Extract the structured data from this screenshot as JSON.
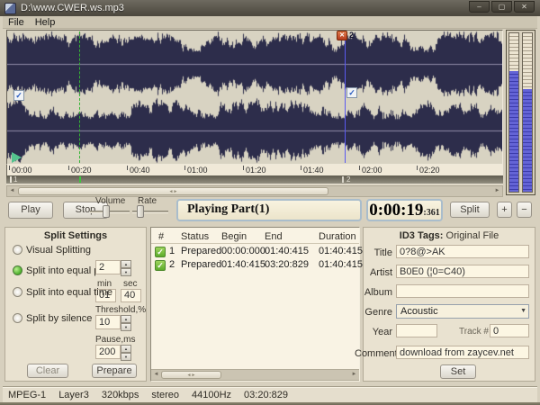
{
  "window": {
    "title": "D:\\www.CWER.ws.mp3",
    "minimize_glyph": "–",
    "maximize_glyph": "▢",
    "close_glyph": "✕"
  },
  "menu": {
    "items": [
      "File",
      "Help"
    ]
  },
  "waveform": {
    "ruler_labels": [
      "00:00",
      "00:20",
      "00:40",
      "01:00",
      "01:20",
      "01:40",
      "02:00",
      "02:20"
    ],
    "split_marker_number": "2",
    "marker_close_glyph": "✕",
    "marker_check_glyph": "✓",
    "strip_marker_start": "1",
    "strip_marker_split": "2"
  },
  "icons": {
    "scroll_left": "◄",
    "scroll_right": "►",
    "thumb_grip": "◄►",
    "spin_up": "▲",
    "spin_down": "▼",
    "dropdown_arrow": "▼"
  },
  "transport": {
    "play_label": "Play",
    "stop_label": "Stop",
    "volume_label": "Volume",
    "rate_label": "Rate",
    "status_text": "Playing Part(1)",
    "time_main": "0:00:19",
    "time_frac": ":361",
    "split_label": "Split",
    "plus_label": "+",
    "minus_label": "−"
  },
  "split_settings": {
    "title": "Split Settings",
    "option_visual": "Visual Splitting",
    "option_equal_parts": "Split into equal parts",
    "option_equal_time": "Split into equal time",
    "option_silence": "Split by silence",
    "parts_value": "2",
    "min_label": "min",
    "sec_label": "sec",
    "min_value": "01",
    "sec_value": "40",
    "threshold_label": "Threshold,%",
    "threshold_value": "10",
    "pause_label": "Pause,ms",
    "pause_value": "200",
    "clear_label": "Clear",
    "prepare_label": "Prepare"
  },
  "parts_table": {
    "headers": [
      "#",
      "Status",
      "Begin",
      "End",
      "Duration"
    ],
    "rows": [
      {
        "num": "1",
        "status": "Prepared",
        "begin": "00:00:000",
        "end": "01:40:415",
        "duration": "01:40:415",
        "check": "✓"
      },
      {
        "num": "2",
        "status": "Prepared",
        "begin": "01:40:415",
        "end": "03:20:829",
        "duration": "01:40:415",
        "check": "✓"
      }
    ]
  },
  "id3": {
    "header_bold": "ID3 Tags:",
    "header_normal": "Original File",
    "labels": {
      "title": "Title",
      "artist": "Artist",
      "album": "Album",
      "genre": "Genre",
      "year": "Year",
      "track": "Track #",
      "comment": "Comment"
    },
    "values": {
      "title": "0?8@>AK",
      "artist": "B0E0 (¦0=C40)",
      "album": "",
      "genre": "Acoustic",
      "year": "",
      "track": "0",
      "comment": "download from zaycev.net"
    },
    "set_label": "Set"
  },
  "status_bar": {
    "items": [
      "MPEG-1",
      "Layer3",
      "320kbps",
      "stereo",
      "44100Hz",
      "03:20:829"
    ]
  }
}
